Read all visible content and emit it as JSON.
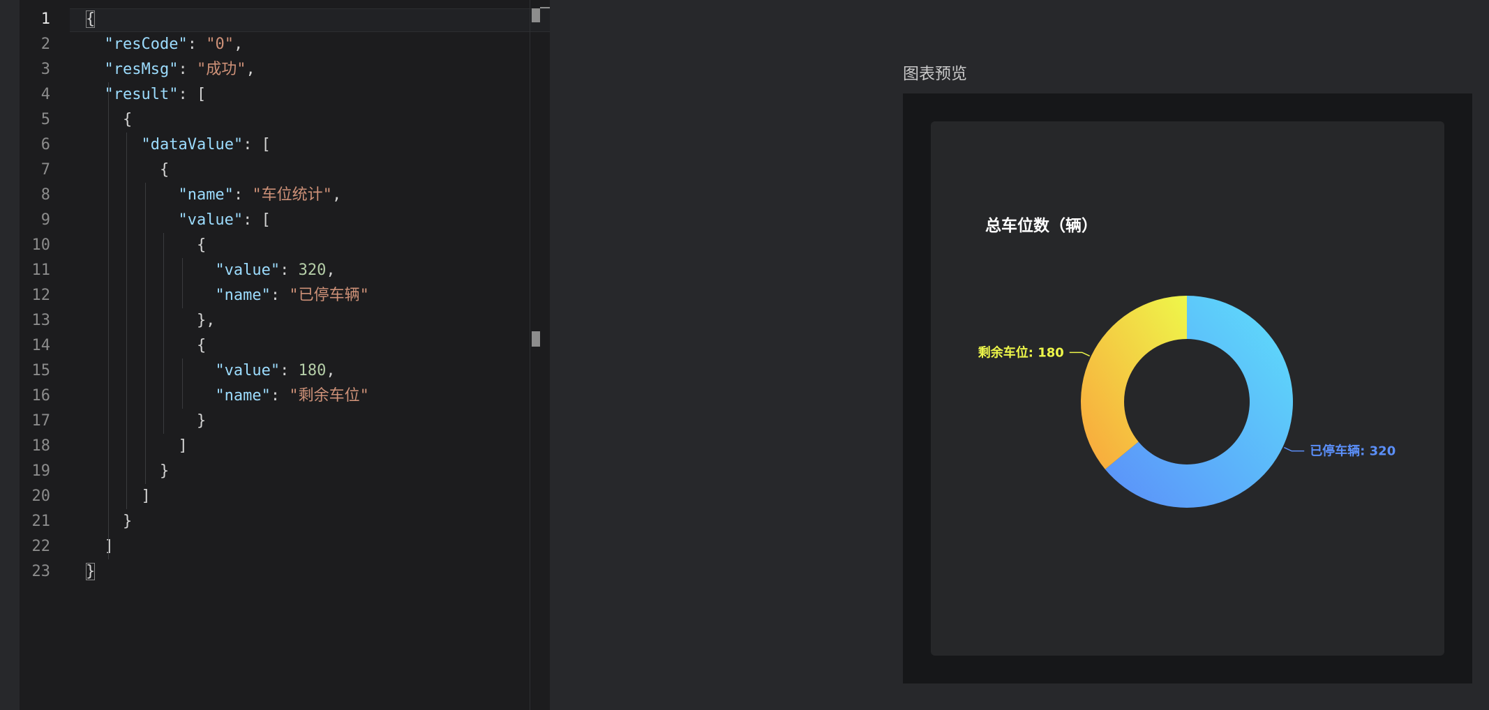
{
  "editor": {
    "line_numbers": [
      "1",
      "2",
      "3",
      "4",
      "5",
      "6",
      "7",
      "8",
      "9",
      "10",
      "11",
      "12",
      "13",
      "14",
      "15",
      "16",
      "17",
      "18",
      "19",
      "20",
      "21",
      "22",
      "23"
    ],
    "lines": [
      [
        {
          "t": "{",
          "c": "pun"
        }
      ],
      [
        {
          "t": "  "
        },
        {
          "t": "\"resCode\"",
          "c": "key"
        },
        {
          "t": ": "
        },
        {
          "t": "\"0\"",
          "c": "str"
        },
        {
          "t": ","
        }
      ],
      [
        {
          "t": "  "
        },
        {
          "t": "\"resMsg\"",
          "c": "key"
        },
        {
          "t": ": "
        },
        {
          "t": "\"成功\"",
          "c": "str"
        },
        {
          "t": ","
        }
      ],
      [
        {
          "t": "  "
        },
        {
          "t": "\"result\"",
          "c": "key"
        },
        {
          "t": ": ["
        }
      ],
      [
        {
          "t": "    {"
        }
      ],
      [
        {
          "t": "      "
        },
        {
          "t": "\"dataValue\"",
          "c": "key"
        },
        {
          "t": ": ["
        }
      ],
      [
        {
          "t": "        {"
        }
      ],
      [
        {
          "t": "          "
        },
        {
          "t": "\"name\"",
          "c": "key"
        },
        {
          "t": ": "
        },
        {
          "t": "\"车位统计\"",
          "c": "str"
        },
        {
          "t": ","
        }
      ],
      [
        {
          "t": "          "
        },
        {
          "t": "\"value\"",
          "c": "key"
        },
        {
          "t": ": ["
        }
      ],
      [
        {
          "t": "            {"
        }
      ],
      [
        {
          "t": "              "
        },
        {
          "t": "\"value\"",
          "c": "key"
        },
        {
          "t": ": "
        },
        {
          "t": "320",
          "c": "num"
        },
        {
          "t": ","
        }
      ],
      [
        {
          "t": "              "
        },
        {
          "t": "\"name\"",
          "c": "key"
        },
        {
          "t": ": "
        },
        {
          "t": "\"已停车辆\"",
          "c": "str"
        }
      ],
      [
        {
          "t": "            },"
        }
      ],
      [
        {
          "t": "            {"
        }
      ],
      [
        {
          "t": "              "
        },
        {
          "t": "\"value\"",
          "c": "key"
        },
        {
          "t": ": "
        },
        {
          "t": "180",
          "c": "num"
        },
        {
          "t": ","
        }
      ],
      [
        {
          "t": "              "
        },
        {
          "t": "\"name\"",
          "c": "key"
        },
        {
          "t": ": "
        },
        {
          "t": "\"剩余车位\"",
          "c": "str"
        }
      ],
      [
        {
          "t": "            }"
        }
      ],
      [
        {
          "t": "          ]"
        }
      ],
      [
        {
          "t": "        }"
        }
      ],
      [
        {
          "t": "      ]"
        }
      ],
      [
        {
          "t": "    }"
        }
      ],
      [
        {
          "t": "  ]"
        }
      ],
      [
        {
          "t": "}",
          "c": "pun"
        }
      ]
    ]
  },
  "preview": {
    "label": "图表预览",
    "chart_title": "总车位数（辆）"
  },
  "chart_data": {
    "type": "pie",
    "variant": "donut",
    "title": "总车位数（辆）",
    "slices": [
      {
        "name": "已停车辆",
        "value": 320,
        "label": "已停车辆: 320",
        "color_from": "#5b8ff9",
        "color_to": "#5ee0fb",
        "label_color": "#5b8ff9"
      },
      {
        "name": "剩余车位",
        "value": 180,
        "label": "剩余车位: 180",
        "color_from": "#f9a53c",
        "color_to": "#eef74a",
        "label_color": "#eef74a"
      }
    ]
  }
}
